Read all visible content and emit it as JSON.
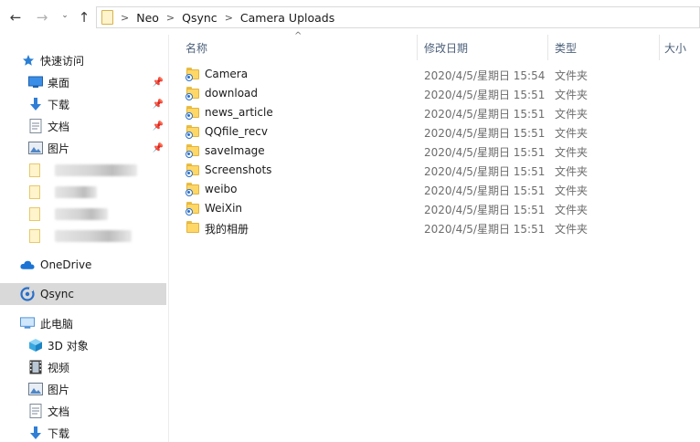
{
  "address": {
    "back_glyph": "←",
    "forward_glyph": "→",
    "recent_glyph": "⌄",
    "up_glyph": "↑",
    "crumbs": [
      "Neo",
      "Qsync",
      "Camera Uploads"
    ],
    "separator": ">"
  },
  "sidebar": {
    "quick_access": {
      "label": "快速访问",
      "items": [
        {
          "label": "桌面",
          "icon": "desktop-icon",
          "pinned": true
        },
        {
          "label": "下载",
          "icon": "download-arrow-icon",
          "pinned": true
        },
        {
          "label": "文档",
          "icon": "document-icon",
          "pinned": true
        },
        {
          "label": "图片",
          "icon": "picture-icon",
          "pinned": true
        }
      ]
    },
    "onedrive": {
      "label": "OneDrive",
      "icon": "cloud-icon"
    },
    "qsync": {
      "label": "Qsync",
      "icon": "qsync-icon"
    },
    "this_pc": {
      "label": "此电脑",
      "items": [
        {
          "label": "3D 对象",
          "icon": "cube-3d-icon"
        },
        {
          "label": "视频",
          "icon": "film-icon"
        },
        {
          "label": "图片",
          "icon": "picture-icon"
        },
        {
          "label": "文档",
          "icon": "document-icon"
        },
        {
          "label": "下载",
          "icon": "download-arrow-icon"
        }
      ]
    }
  },
  "columns": {
    "name": "名称",
    "modified": "修改日期",
    "type": "类型",
    "size": "大小"
  },
  "files": [
    {
      "name": "Camera",
      "modified": "2020/4/5/星期日 15:54",
      "type": "文件夹"
    },
    {
      "name": "download",
      "modified": "2020/4/5/星期日 15:51",
      "type": "文件夹"
    },
    {
      "name": "news_article",
      "modified": "2020/4/5/星期日 15:51",
      "type": "文件夹"
    },
    {
      "name": "QQfile_recv",
      "modified": "2020/4/5/星期日 15:51",
      "type": "文件夹"
    },
    {
      "name": "saveImage",
      "modified": "2020/4/5/星期日 15:51",
      "type": "文件夹"
    },
    {
      "name": "Screenshots",
      "modified": "2020/4/5/星期日 15:51",
      "type": "文件夹"
    },
    {
      "name": "weibo",
      "modified": "2020/4/5/星期日 15:51",
      "type": "文件夹"
    },
    {
      "name": "WeiXin",
      "modified": "2020/4/5/星期日 15:51",
      "type": "文件夹"
    },
    {
      "name": "我的相册",
      "modified": "2020/4/5/星期日 15:51",
      "type": "文件夹"
    }
  ],
  "colors": {
    "accent": "#2a6fc9",
    "folder": "#ffd766",
    "selected": "#d9d9d9",
    "header_text": "#4c607a"
  }
}
